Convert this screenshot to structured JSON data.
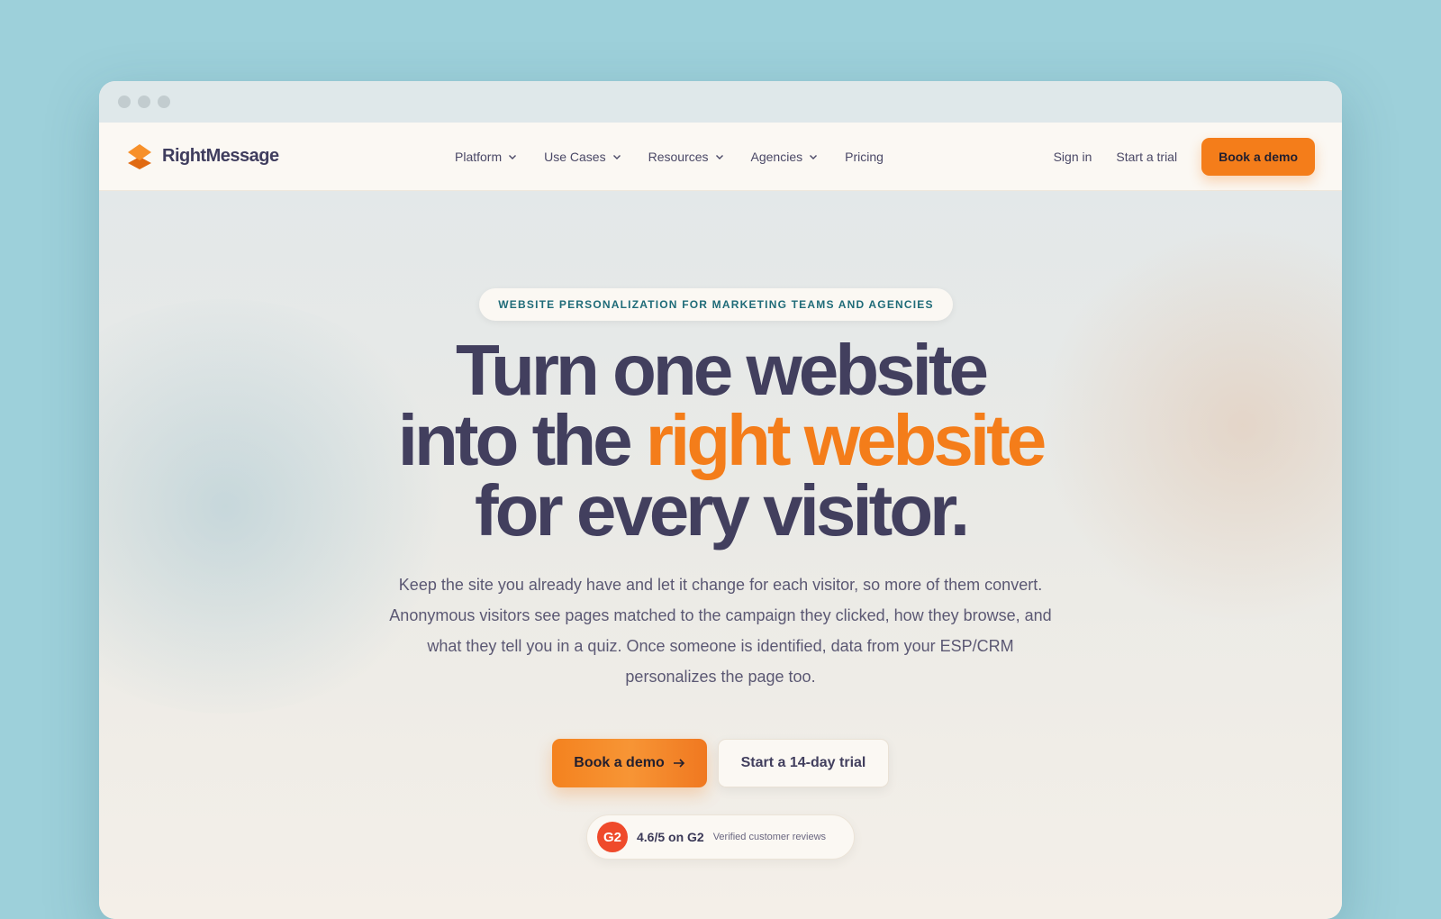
{
  "nav": {
    "brand": "RightMessage",
    "links": [
      {
        "label": "Platform",
        "has_dropdown": true
      },
      {
        "label": "Use Cases",
        "has_dropdown": true
      },
      {
        "label": "Resources",
        "has_dropdown": true
      },
      {
        "label": "Agencies",
        "has_dropdown": true
      },
      {
        "label": "Pricing",
        "has_dropdown": false
      }
    ],
    "sign_in": "Sign in",
    "start_trial": "Start a trial",
    "book_demo": "Book a demo"
  },
  "hero": {
    "eyebrow": "WEBSITE PERSONALIZATION FOR MARKETING TEAMS AND AGENCIES",
    "headline_line1": "Turn one website",
    "headline_line2_pre": "into the ",
    "headline_line2_accent": "right website",
    "headline_line3": "for every visitor.",
    "subtext": "Keep the site you already have and let it change for each visitor, so more of them convert. Anonymous visitors see pages matched to the campaign they clicked, how they browse, and what they tell you in a quiz. Once someone is identified, data from your ESP/CRM personalizes the page too.",
    "primary_cta": "Book a demo",
    "secondary_cta": "Start a 14-day trial",
    "rating": {
      "badge": "G2",
      "score": "4.6/5 on G2",
      "label": "Verified customer reviews"
    }
  },
  "colors": {
    "accent": "#f47d1a",
    "heading": "#423f5e",
    "eyebrow": "#1f6b78",
    "g2": "#ef4a2b"
  },
  "icons": [
    "window-dot-icon",
    "logo-icon",
    "chevron-down-icon",
    "arrow-right-icon",
    "g2-logo-icon"
  ]
}
